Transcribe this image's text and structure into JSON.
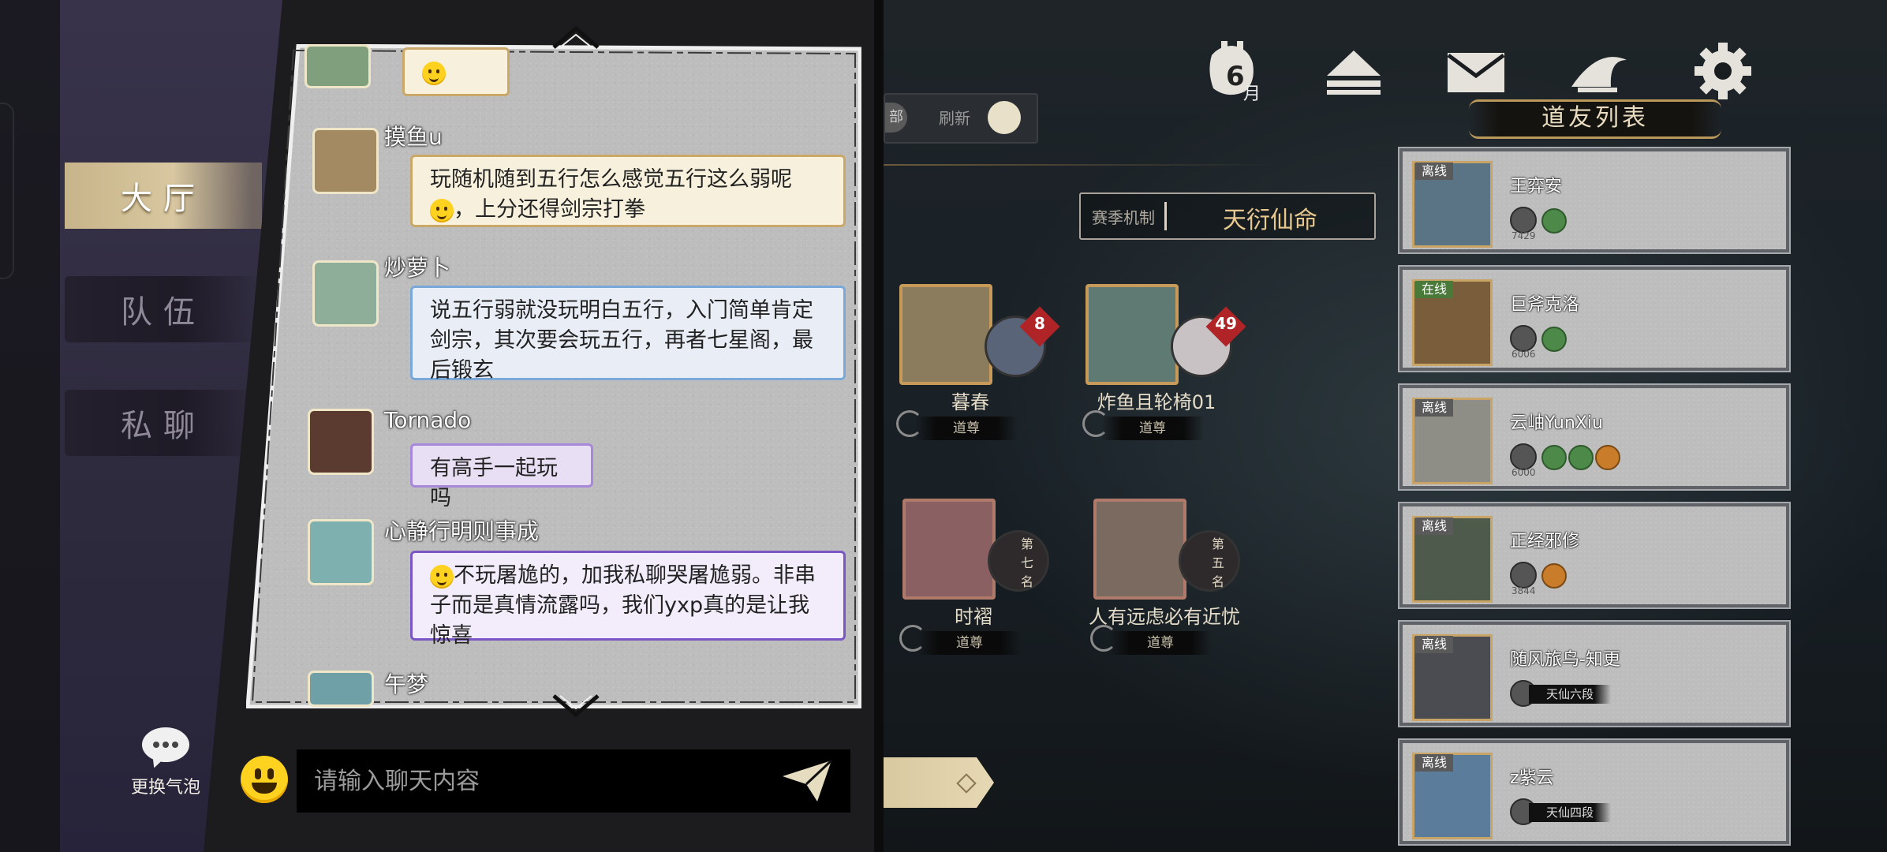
{
  "tabs": [
    {
      "label": "大厅",
      "active": true
    },
    {
      "label": "队伍",
      "active": false
    },
    {
      "label": "私聊",
      "active": false
    }
  ],
  "bubble_button": {
    "label": "更换气泡",
    "icon": "speech-bubble-icon"
  },
  "messages": [
    {
      "name": "摸鱼u",
      "text": "玩随机随到五行怎么感觉五行这么弱呢",
      "text2": "，上分还得剑宗打拳",
      "style": "paper"
    },
    {
      "name": "炒萝卜",
      "text": "说五行弱就没玩明白五行，入门简单肯定剑宗，其次要会玩五行，再者七星阁，最后锻玄",
      "style": "blue"
    },
    {
      "name": "Tornado",
      "text": "有高手一起玩吗",
      "style": "purple"
    },
    {
      "name": "心静行明则事成",
      "text": "不玩屠尯的，加我私聊哭屠尯弱。非串子而是真情流露吗，我们yxp真的是让我惊喜",
      "style": "purple2"
    },
    {
      "name": "午梦",
      "text": "",
      "style": "blue"
    }
  ],
  "chat_input": {
    "placeholder": "请输入聊天内容",
    "value": ""
  },
  "top_icons": [
    {
      "name": "calendar-icon",
      "label": "6",
      "sub": "月"
    },
    {
      "name": "eject-icon"
    },
    {
      "name": "mail-icon"
    },
    {
      "name": "straw-hat-icon"
    },
    {
      "name": "gear-icon"
    }
  ],
  "refresh": {
    "partial_label": "部",
    "label": "刷新"
  },
  "season": {
    "label": "赛季机制",
    "value": "天衍仙命"
  },
  "players": [
    {
      "name": "暮春",
      "tag": "道尊",
      "badge": "8"
    },
    {
      "name": "炸鱼且轮椅01",
      "tag": "道尊",
      "badge": "49"
    },
    {
      "name": "时褶",
      "tag": "道尊",
      "rank": "第七名"
    },
    {
      "name": "人有远虑必有近忧",
      "tag": "道尊",
      "rank": "第五名"
    }
  ],
  "friends_title": "道友列表",
  "friends": [
    {
      "status": "离线",
      "name": "王弈安",
      "score": "7429",
      "gems": 2,
      "rank_tag": ""
    },
    {
      "status": "在线",
      "name": "巨斧克洛",
      "score": "6006",
      "gems": 1,
      "rank_tag": ""
    },
    {
      "status": "离线",
      "name": "云岫YunXiu",
      "score": "6000",
      "gems": 3,
      "rank_tag": ""
    },
    {
      "status": "离线",
      "name": "正经邪修",
      "score": "3844",
      "gems": 1,
      "rank_tag": ""
    },
    {
      "status": "离线",
      "name": "随风旅鸟-知更",
      "score": "",
      "gems": 0,
      "rank_tag": "天仙六段"
    },
    {
      "status": "离线",
      "name": "z紫云",
      "score": "",
      "gems": 0,
      "rank_tag": "天仙四段"
    }
  ],
  "colors": {
    "paper": "#bdbdbd",
    "gold": "#c79a5a",
    "active_tab": "#d8c7a0"
  }
}
